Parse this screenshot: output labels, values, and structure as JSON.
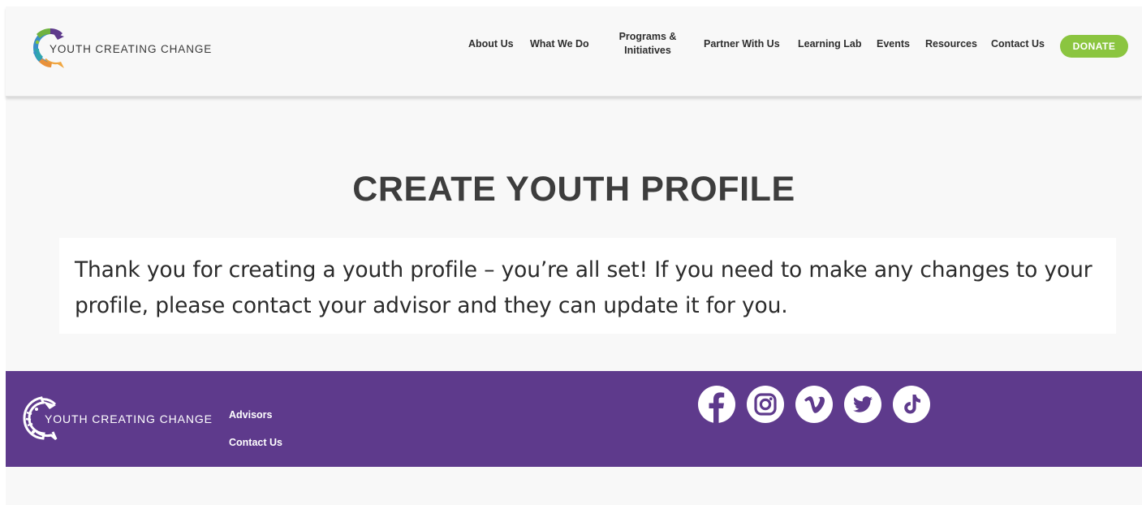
{
  "header": {
    "logo_text": "YOUTH CREATING CHANGE",
    "nav": [
      {
        "label": "About Us"
      },
      {
        "label": "What We Do"
      },
      {
        "label": "Programs &",
        "label2": "Initiatives"
      },
      {
        "label": "Partner With Us"
      },
      {
        "label": "Learning Lab"
      },
      {
        "label": "Events"
      },
      {
        "label": "Resources"
      },
      {
        "label": "Contact Us"
      }
    ],
    "donate_label": "DONATE"
  },
  "main": {
    "title": "CREATE YOUTH PROFILE",
    "message": "Thank you for creating a youth profile – you’re all set! If you need to make any changes to your profile, please contact your advisor and they can update it for you."
  },
  "footer": {
    "logo_text": "YOUTH CREATING CHANGE",
    "links": [
      "Advisors",
      "Contact Us"
    ],
    "social_icons": [
      "facebook-icon",
      "instagram-icon",
      "vimeo-icon",
      "twitter-icon",
      "tiktok-icon"
    ]
  },
  "colors": {
    "footer_bg": "#5e3a8c",
    "donate_bg": "#8bc540",
    "page_bg": "#f8f8f8"
  }
}
